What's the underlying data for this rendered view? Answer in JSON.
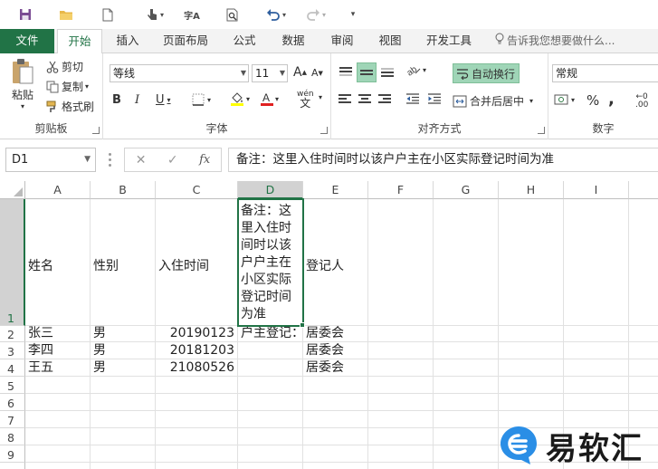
{
  "qat": {
    "save_icon": "save-icon",
    "open_icon": "folder-icon",
    "new_icon": "new-doc-icon",
    "touch_icon": "touch-icon",
    "spell_label": "字A",
    "preview_icon": "print-preview-icon",
    "undo_icon": "undo-icon",
    "redo_icon": "redo-icon"
  },
  "tabs": {
    "file": "文件",
    "items": [
      "开始",
      "插入",
      "页面布局",
      "公式",
      "数据",
      "审阅",
      "视图",
      "开发工具"
    ],
    "tell_me": "告诉我您想要做什么..."
  },
  "ribbon": {
    "clipboard": {
      "paste": "粘贴",
      "cut": "剪切",
      "copy": "复制",
      "format_painter": "格式刷",
      "label": "剪贴板"
    },
    "font": {
      "name": "等线",
      "size": "11",
      "grow": "A",
      "shrink": "A",
      "bold": "B",
      "italic": "I",
      "underline": "U",
      "phonetic": "wén",
      "label": "字体"
    },
    "alignment": {
      "wrap_text": "自动换行",
      "merge_center": "合并后居中",
      "label": "对齐方式"
    },
    "number": {
      "format": "常规",
      "percent": "%",
      "comma": ",",
      "label": "数字"
    }
  },
  "formula_bar": {
    "name_box": "D1",
    "cancel": "✕",
    "enter": "✓",
    "fx": "fx",
    "content": "备注：这里入住时间时以该户户主在小区实际登记时间为准"
  },
  "grid": {
    "columns": [
      "A",
      "B",
      "C",
      "D",
      "E",
      "F",
      "G",
      "H",
      "I"
    ],
    "rows": [
      "1",
      "2",
      "3",
      "4",
      "5",
      "6",
      "7",
      "8",
      "9"
    ],
    "cells": {
      "A1": "姓名",
      "B1": "性别",
      "C1": "入住时间",
      "D1": "备注：这里入住时间时以该户户主在小区实际登记时间为准",
      "E1": "登记人",
      "A2": "张三",
      "B2": "男",
      "C2": "20190123",
      "D2": "户主登记：",
      "E2": "居委会",
      "A3": "李四",
      "B3": "男",
      "C3": "20181203",
      "E3": "居委会",
      "A4": "王五",
      "B4": "男",
      "C4": "21080526",
      "E4": "居委会"
    }
  },
  "watermark": {
    "text": "易软汇"
  },
  "colors": {
    "accent": "#217346",
    "selected_header": "#d2d2d2"
  }
}
